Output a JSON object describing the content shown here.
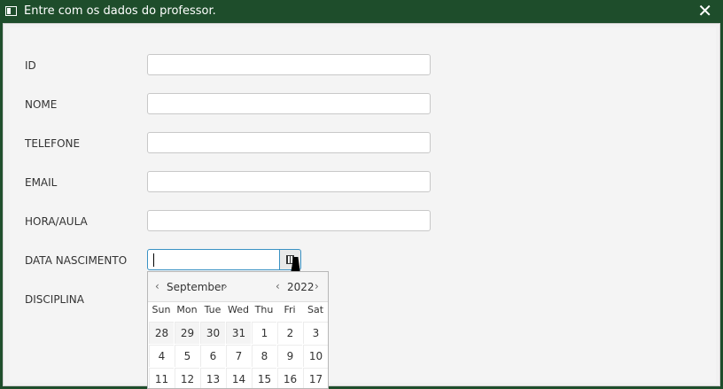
{
  "window": {
    "title": "Entre com os dados do professor.",
    "close_symbol": "✕"
  },
  "form": {
    "fields": [
      {
        "label": "ID",
        "value": ""
      },
      {
        "label": "NOME",
        "value": ""
      },
      {
        "label": "TELEFONE",
        "value": ""
      },
      {
        "label": "EMAIL",
        "value": ""
      },
      {
        "label": "HORA/AULA",
        "value": ""
      }
    ],
    "date": {
      "label": "DATA NASCIMENTO",
      "value": ""
    },
    "discipline": {
      "label": "DISCIPLINA"
    }
  },
  "calendar": {
    "month": "September",
    "year": "2022",
    "prev": "‹",
    "next": "›",
    "weekdays": [
      "Sun",
      "Mon",
      "Tue",
      "Wed",
      "Thu",
      "Fri",
      "Sat"
    ],
    "weeks": [
      [
        "28",
        "29",
        "30",
        "31",
        "1",
        "2",
        "3"
      ],
      [
        "4",
        "5",
        "6",
        "7",
        "8",
        "9",
        "10"
      ],
      [
        "11",
        "12",
        "13",
        "14",
        "15",
        "16",
        "17"
      ]
    ]
  }
}
